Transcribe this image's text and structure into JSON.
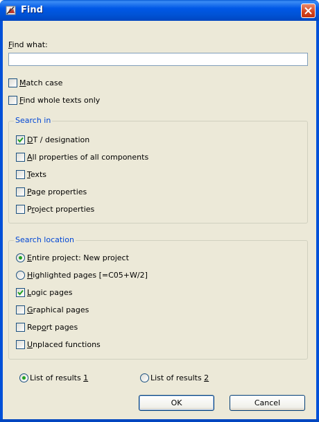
{
  "window": {
    "title": "Find",
    "close_label": "close"
  },
  "find": {
    "label_accel": "F",
    "label_rest": "ind what:",
    "value": ""
  },
  "options": {
    "match_case": {
      "accel": "M",
      "rest": "atch case",
      "checked": false
    },
    "whole_texts": {
      "accel": "F",
      "rest": "ind whole texts only",
      "checked": false
    }
  },
  "search_in": {
    "title": "Search in",
    "items": [
      {
        "accel": "D",
        "rest": "T / designation",
        "checked": true
      },
      {
        "accel": "A",
        "rest": "ll properties of all components",
        "checked": false
      },
      {
        "accel": "T",
        "rest": "exts",
        "checked": false
      },
      {
        "accel": "P",
        "rest": "age properties",
        "checked": false
      },
      {
        "pre": "P",
        "accel": "r",
        "rest": "oject properties",
        "checked": false
      }
    ]
  },
  "search_location": {
    "title": "Search location",
    "radios": [
      {
        "accel": "E",
        "rest": "ntire project: New project",
        "selected": true
      },
      {
        "accel": "H",
        "rest": "ighlighted pages [=C05+W/2]",
        "selected": false
      }
    ],
    "checks": [
      {
        "accel": "L",
        "rest": "ogic pages",
        "checked": true
      },
      {
        "accel": "G",
        "rest": "raphical pages",
        "checked": false
      },
      {
        "pre": "Rep",
        "accel": "o",
        "rest": "rt pages",
        "checked": false
      },
      {
        "accel": "U",
        "rest": "nplaced functions",
        "checked": false
      }
    ]
  },
  "results": {
    "one": {
      "pre": "List of results ",
      "accel": "1",
      "selected": true
    },
    "two": {
      "pre": "List of results ",
      "accel": "2",
      "selected": false
    }
  },
  "buttons": {
    "ok": "OK",
    "cancel": "Cancel"
  },
  "colors": {
    "titlebar": "#0058e6",
    "dialog_bg": "#ece9d8",
    "group_title": "#0046d5",
    "check": "#21a121",
    "close": "#d4421c"
  }
}
